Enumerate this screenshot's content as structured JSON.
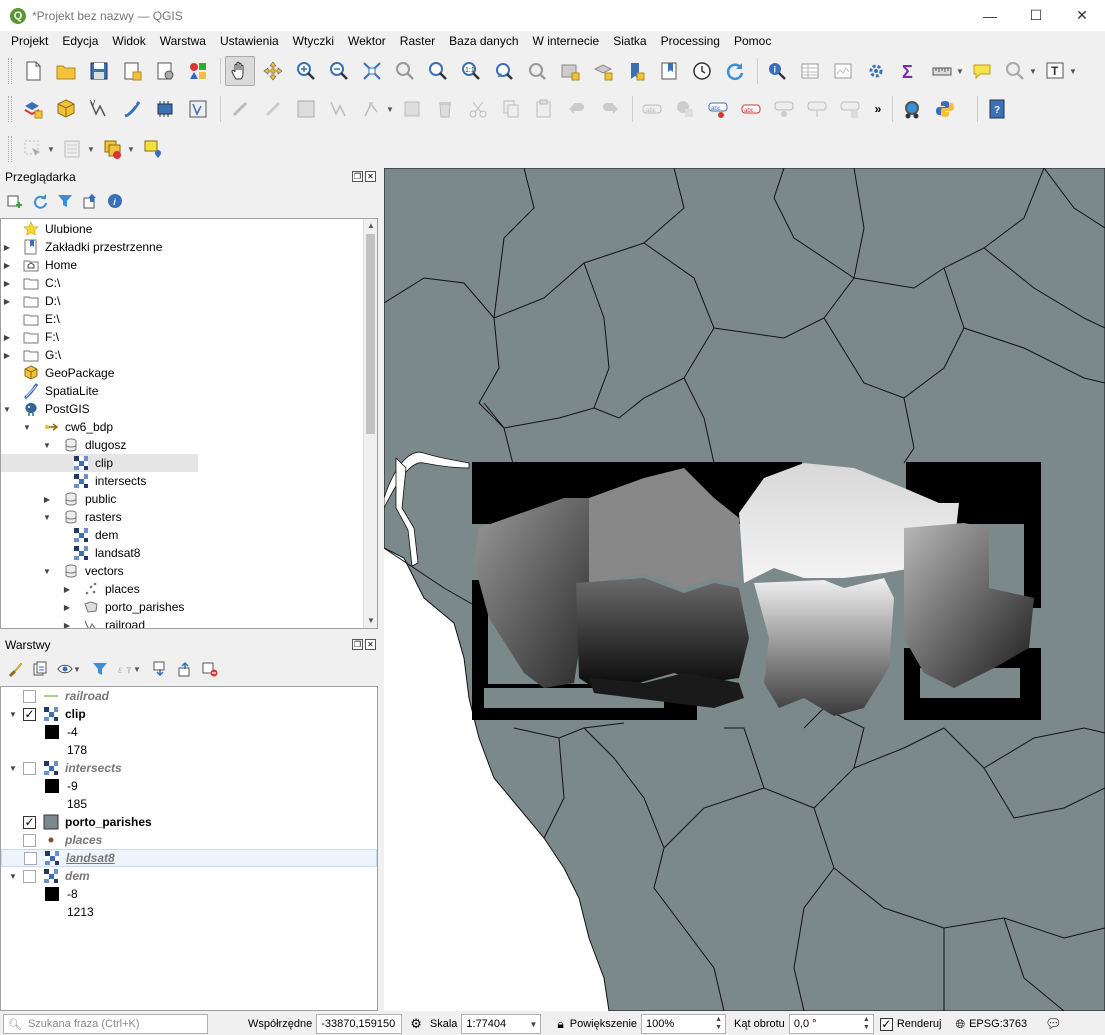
{
  "window": {
    "title": "*Projekt bez nazwy — QGIS",
    "app_icon": "Q",
    "minimize": "—",
    "maximize": "☐",
    "close": "✕"
  },
  "menu": [
    "Projekt",
    "Edycja",
    "Widok",
    "Warstwa",
    "Ustawienia",
    "Wtyczki",
    "Wektor",
    "Raster",
    "Baza danych",
    "W internecie",
    "Siatka",
    "Processing",
    "Pomoc"
  ],
  "browser": {
    "title": "Przeglądarka",
    "items": [
      {
        "label": "Ulubione",
        "icon": "star-icon"
      },
      {
        "label": "Zakładki przestrzenne",
        "icon": "bookmark-icon"
      },
      {
        "label": "Home",
        "icon": "home-folder-icon"
      },
      {
        "label": "C:\\",
        "icon": "folder-icon"
      },
      {
        "label": "D:\\",
        "icon": "folder-icon"
      },
      {
        "label": "E:\\",
        "icon": "folder-icon"
      },
      {
        "label": "F:\\",
        "icon": "folder-icon"
      },
      {
        "label": "G:\\",
        "icon": "folder-icon"
      },
      {
        "label": "GeoPackage",
        "icon": "geopackage-icon"
      },
      {
        "label": "SpatiaLite",
        "icon": "spatialite-icon"
      },
      {
        "label": "PostGIS",
        "icon": "postgis-icon"
      },
      {
        "label": "cw6_bdp",
        "icon": "connection-icon"
      },
      {
        "label": "dlugosz",
        "icon": "schema-icon"
      },
      {
        "label": "clip",
        "icon": "raster-icon"
      },
      {
        "label": "intersects",
        "icon": "raster-icon"
      },
      {
        "label": "public",
        "icon": "schema-icon"
      },
      {
        "label": "rasters",
        "icon": "schema-icon"
      },
      {
        "label": "dem",
        "icon": "raster-icon"
      },
      {
        "label": "landsat8",
        "icon": "raster-icon"
      },
      {
        "label": "vectors",
        "icon": "schema-icon"
      },
      {
        "label": "places",
        "icon": "point-layer-icon"
      },
      {
        "label": "porto_parishes",
        "icon": "polygon-layer-icon"
      },
      {
        "label": "railroad",
        "icon": "line-layer-icon"
      }
    ]
  },
  "layers": {
    "title": "Warstwy",
    "items": [
      {
        "name": "railroad",
        "checked": false
      },
      {
        "name": "clip",
        "checked": true,
        "min": "-4",
        "max": "178"
      },
      {
        "name": "intersects",
        "checked": false,
        "min": "-9",
        "max": "185"
      },
      {
        "name": "porto_parishes",
        "checked": true
      },
      {
        "name": "places",
        "checked": false
      },
      {
        "name": "landsat8",
        "checked": false
      },
      {
        "name": "dem",
        "checked": false,
        "min": "-8",
        "max": "1213"
      }
    ]
  },
  "status": {
    "search_placeholder": "Szukana fraza (Ctrl+K)",
    "coord_label": "Współrzędne",
    "coord_value": "-33870,159150",
    "scale_label": "Skala",
    "scale_value": "1:77404",
    "magnifier_label": "Powiększenie",
    "magnifier_value": "100%",
    "rotation_label": "Kąt obrotu",
    "rotation_value": "0,0 °",
    "render_label": "Renderuj",
    "crs": "EPSG:3763"
  },
  "colors": {
    "map_land": "#7c898b",
    "map_sea": "#ffffff",
    "boundary": "#1a1a1a",
    "qgis_green": "#589632"
  }
}
